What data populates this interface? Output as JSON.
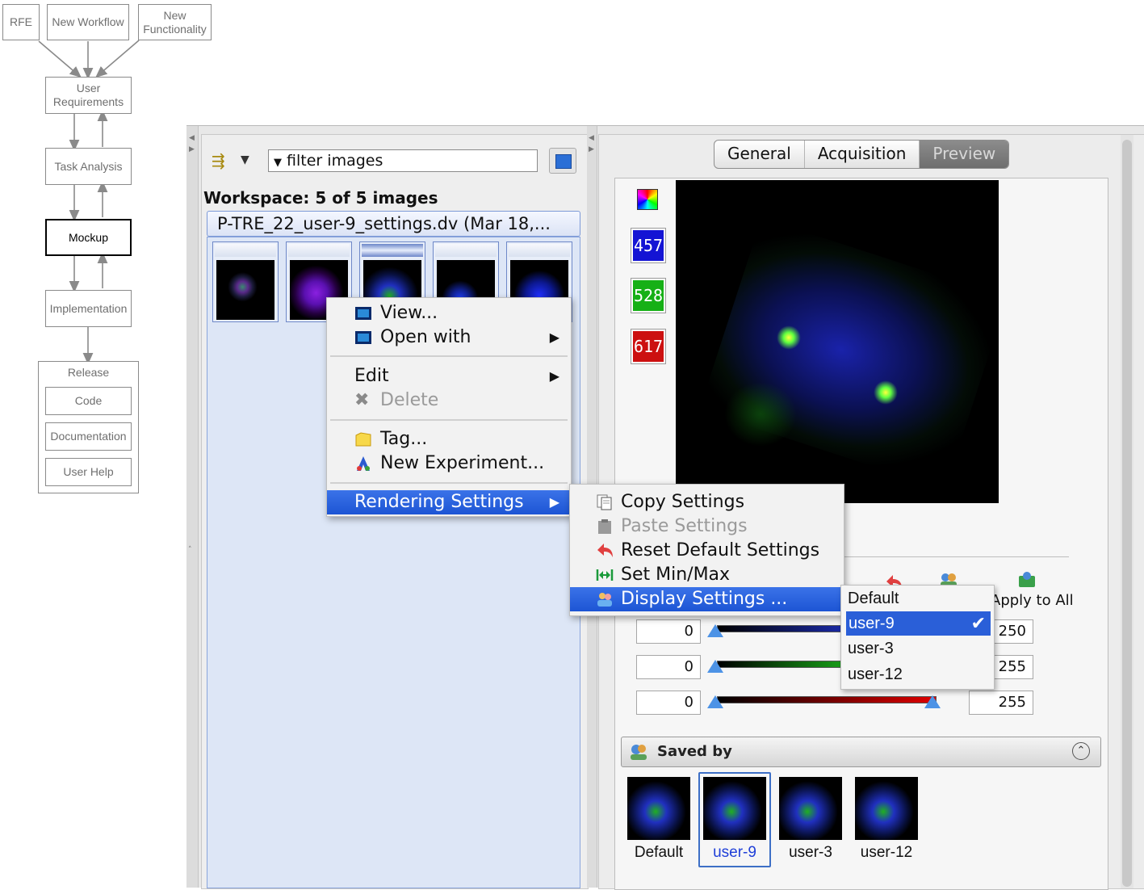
{
  "workflow": {
    "rfe": "RFE",
    "new_workflow": "New Workflow",
    "new_functionality": "New Functionality",
    "user_requirements": "User Requirements",
    "task_analysis": "Task Analysis",
    "mockup": "Mockup",
    "implementation": "Implementation",
    "release": "Release",
    "code": "Code",
    "documentation": "Documentation",
    "user_help": "User Help"
  },
  "left_panel": {
    "filter_text": "filter  images",
    "workspace_label": "Workspace: 5 of 5 images",
    "dataset_title": "P-TRE_22_user-9_settings.dv (Mar 18,..."
  },
  "context_menu": {
    "view": "View...",
    "open_with": "Open with",
    "edit": "Edit",
    "delete": "Delete",
    "tag": "Tag...",
    "new_experiment": "New Experiment...",
    "rendering_settings": "Rendering Settings"
  },
  "rendering_submenu": {
    "copy": "Copy Settings",
    "paste": "Paste Settings",
    "reset": "Reset Default Settings",
    "set_min_max": "Set Min/Max",
    "display": "Display Settings ..."
  },
  "user_menu": {
    "items": [
      "Default",
      "user-9",
      "user-3",
      "user-12"
    ],
    "selected": "user-9"
  },
  "tabs": {
    "general": "General",
    "acquisition": "Acquisition",
    "preview": "Preview"
  },
  "channels": {
    "blue": {
      "label": "457",
      "color": "#1414d4"
    },
    "green": {
      "label": "528",
      "color": "#16b016"
    },
    "red": {
      "label": "617",
      "color": "#cc1010"
    }
  },
  "sliders": {
    "rows": [
      {
        "min": "0",
        "max": "250"
      },
      {
        "min": "0",
        "max": "255"
      },
      {
        "min": "0",
        "max": "255"
      }
    ]
  },
  "apply_to_all": "Apply to All",
  "saved_by": {
    "label": "Saved by",
    "users": [
      "Default",
      "user-9",
      "user-3",
      "user-12"
    ],
    "selected": "user-9"
  }
}
